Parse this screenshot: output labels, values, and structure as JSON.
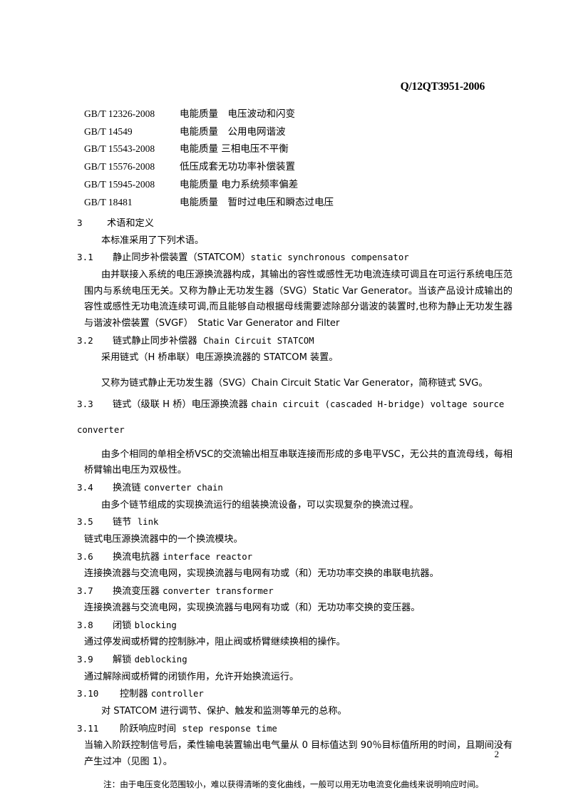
{
  "document": {
    "header_code": "Q/12QT3951-2006",
    "page_number": "2"
  },
  "normative_references": {
    "rows": [
      {
        "code": "GB/T 12326-2008",
        "title": "电能质量　电压波动和闪变"
      },
      {
        "code": "GB/T 14549",
        "title": "电能质量　公用电网谐波"
      },
      {
        "code": "GB/T 15543-2008",
        "title": "电能质量 三相电压不平衡"
      },
      {
        "code": "GB/T 15576-2008",
        "title": "低压成套无功功率补偿装置"
      },
      {
        "code": "GB/T 15945-2008",
        "title": "电能质量 电力系统频率偏差"
      },
      {
        "code": "GB/T 18481",
        "title": "电能质量　暂时过电压和瞬态过电压"
      }
    ]
  },
  "clause3": {
    "number": "3",
    "title": "术语和定义",
    "intro": "本标准采用了下列术语。",
    "terms": [
      {
        "number": "3.1",
        "cn": "静止同步补偿装置（STATCOM）",
        "en": "static synchronous compensator",
        "definition": "由并联接入系统的电压源换流器构成，其输出的容性或感性无功电流连续可调且在可运行系统电压范围内与系统电压无关。又称为静止无功发生器（SVG）Static Var Generator。当该产品设计成输出的容性或感性无功电流连续可调,而且能够自动根据母线需要滤除部分谐波的装置时,也称为静止无功发生器与谐波补偿装置（SVGF）　Static Var Generator and Filter"
      },
      {
        "number": "3.2",
        "cn": "链式静止同步补偿器",
        "en": "Chain Circuit STATCOM",
        "definition": "采用链式（H 桥串联）电压源换流器的 STATCOM 装置。",
        "definition2": "又称为链式静止无功发生器（SVG）Chain Circuit Static Var Generator，简称链式 SVG。"
      },
      {
        "number": "3.3",
        "cn": "链式（级联 H 桥）电压源换流器",
        "en": "chain circuit (cascaded H-bridge) voltage source",
        "en_wrap": "converter",
        "definition": "由多个相同的单相全桥VSC的交流输出相互串联连接而形成的多电平VSC，无公共的直流母线，每相桥臂输出电压为双极性。"
      },
      {
        "number": "3.4",
        "cn": "换流链",
        "en": "converter chain",
        "definition": "由多个链节组成的实现换流运行的组装换流设备，可以实现复杂的换流过程。"
      },
      {
        "number": "3.5",
        "cn": "链节",
        "en": "link",
        "definition": "链式电压源换流器中的一个换流模块。"
      },
      {
        "number": "3.6",
        "cn": "换流电抗器",
        "en": "interface reactor",
        "definition": "连接换流器与交流电网，实现换流器与电网有功或（和）无功功率交换的串联电抗器。"
      },
      {
        "number": "3.7",
        "cn": "换流变压器",
        "en": "converter transformer",
        "definition": "连接换流器与交流电网，实现换流器与电网有功或（和）无功功率交换的变压器。"
      },
      {
        "number": "3.8",
        "cn": "闭锁",
        "en": "blocking",
        "definition": "通过停发阀或桥臂的控制脉冲，阻止阀或桥臂继续换相的操作。"
      },
      {
        "number": "3.9",
        "cn": "解锁",
        "en": "deblocking",
        "definition": "通过解除阀或桥臂的闭锁作用，允许开始换流运行。"
      },
      {
        "number": "3.10",
        "cn": "控制器",
        "en": "controller",
        "definition": "对 STATCOM 进行调节、保护、触发和监测等单元的总称。"
      },
      {
        "number": "3.11",
        "cn": "阶跃响应时间",
        "en": "step response time",
        "definition": "当输入阶跃控制信号后，柔性输电装置输出电气量从 0 目标值达到 90％目标值所用的时间，且期间没有产生过冲（见图 1）。",
        "note": "注：由于电压变化范围较小，难以获得清晰的变化曲线，一般可以用无功电流变化曲线来说明响应时间。"
      }
    ]
  }
}
